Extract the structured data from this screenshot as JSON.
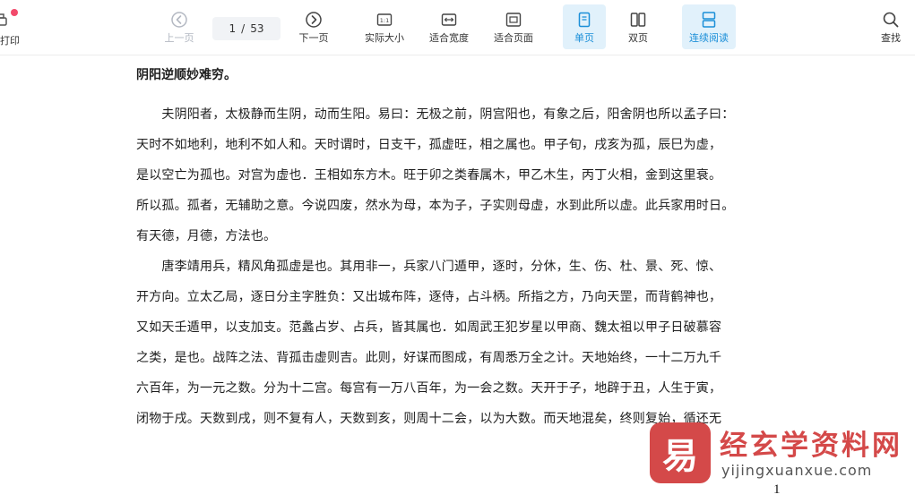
{
  "toolbar": {
    "print": {
      "label": "打印",
      "icon": "print-icon"
    },
    "prev_page": {
      "label": "上一页",
      "icon": "arrow-left-circle-icon",
      "disabled": true
    },
    "page_indicator": {
      "current": "1",
      "separator": "/",
      "total": "53"
    },
    "next_page": {
      "label": "下一页",
      "icon": "arrow-right-circle-icon"
    },
    "actual_size": {
      "label": "实际大小",
      "icon": "actual-size-icon"
    },
    "fit_width": {
      "label": "适合宽度",
      "icon": "fit-width-icon"
    },
    "fit_page": {
      "label": "适合页面",
      "icon": "fit-page-icon"
    },
    "single_page": {
      "label": "单页",
      "icon": "single-page-icon",
      "active": true
    },
    "double_page": {
      "label": "双页",
      "icon": "double-page-icon"
    },
    "continuous": {
      "label": "连续阅读",
      "icon": "continuous-read-icon",
      "active": true
    },
    "search": {
      "label": "查找",
      "icon": "search-icon"
    },
    "accent_color": "#1b8fd8",
    "active_bg": "#e1f1fb",
    "notification_dot_color": "#f24a6b"
  },
  "document": {
    "heading": "阴阳逆顺妙难穷。",
    "lines": [
      "　　夫阴阳者，太极静而生阴，动而生阳。易曰：无极之前，阴宫阳也，有象之后，阳舍阴也所以孟子曰：",
      "天时不如地利，地利不如人和。天时谓时，日支干，孤虚旺，相之属也。甲子旬，戌亥为孤，辰巳为虚，",
      "是以空亡为孤也。对宫为虚也．王相如东方木。旺于卯之类春属木，甲乙木生，丙丁火相，金到这里衰。",
      "所以孤。孤者，无辅助之意。今说四废，然水为母，本为子，子实则母虚，水到此所以虚。此兵家用时日。",
      "有天德，月德，方法也。",
      "　　唐李靖用兵，精风角孤虚是也。其用非一，兵家八门遁甲，逐时，分休，生、伤、杜、景、死、惊、",
      "开方向。立太乙局，逐日分主字胜负：又出城布阵，逐侍，占斗柄。所指之方，乃向天罡，而背鹤神也，",
      "又如天壬遁甲，以支加支。范蠡占岁、占兵，皆其属也．如周武王犯岁星以甲商、魏太祖以甲子日破慕容",
      "之类，是也。战阵之法、背孤击虚则吉。此则，好谋而图成，有周悉万全之计。天地始终，一十二万九千",
      "六百年，为一元之数。分为十二宫。每宫有一万八百年，为一会之数。天开于子，地辟于丑，人生于寅，",
      "闭物于戌。天数到戌，则不复有人，天数到亥，则周十二会，以为大数。而天地混矣，终则复始，循还无"
    ],
    "page_number": "1"
  },
  "watermark": {
    "logo_glyph": "易",
    "title": "经玄学资料网",
    "url": "yijingxuanxue.com",
    "color": "#d44949"
  }
}
